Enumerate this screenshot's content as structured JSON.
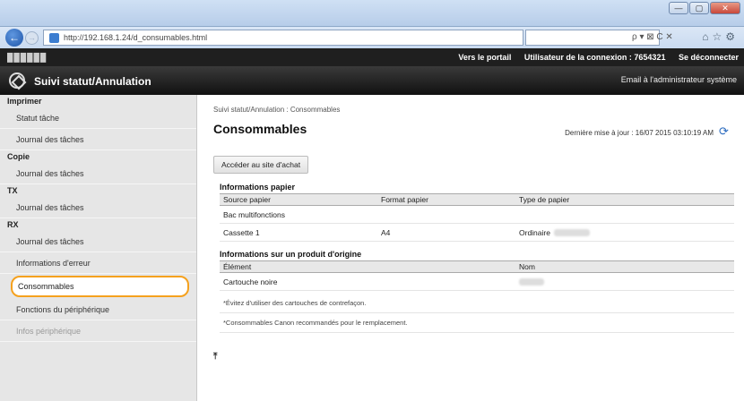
{
  "browser": {
    "url": "http://192.168.1.24/d_consumables.html",
    "search_controls": "ρ ▾ ⊠ C ✕"
  },
  "topbar": {
    "device_name": "██████",
    "portal_link": "Vers le portail",
    "user_label": "Utilisateur de la connexion : 7654321",
    "logout_link": "Se déconnecter"
  },
  "header": {
    "title": "Suivi statut/Annulation",
    "email_link": "Email à l'administrateur système"
  },
  "sidebar": {
    "section_print": "Imprimer",
    "print_job_status": "Statut tâche",
    "print_job_log": "Journal des tâches",
    "section_copy": "Copie",
    "copy_job_log": "Journal des tâches",
    "section_tx": "TX",
    "tx_job_log": "Journal des tâches",
    "section_rx": "RX",
    "rx_job_log": "Journal des tâches",
    "error_info": "Informations d'erreur",
    "consumables": "Consommables",
    "device_features": "Fonctions du périphérique",
    "device_info": "Infos périphérique"
  },
  "main": {
    "breadcrumb": "Suivi statut/Annulation : Consommables",
    "title": "Consommables",
    "last_update": "Dernière mise à jour : 16/07 2015 03:10:19 AM",
    "buy_button": "Accéder au site d'achat",
    "paper_section_title": "Informations papier",
    "paper_headers": [
      "Source papier",
      "Format papier",
      "Type de papier"
    ],
    "paper_rows": [
      [
        "Bac multifonctions",
        "",
        ""
      ],
      [
        "Cassette 1",
        "A4",
        "Ordinaire"
      ]
    ],
    "genuine_section_title": "Informations sur un produit d'origine",
    "genuine_headers": [
      "Élément",
      "Nom"
    ],
    "genuine_rows": [
      [
        "Cartouche noire",
        ""
      ]
    ],
    "note1": "*Évitez d'utiliser des cartouches de contrefaçon.",
    "note2": "*Consommables Canon recommandés pour le remplacement."
  }
}
